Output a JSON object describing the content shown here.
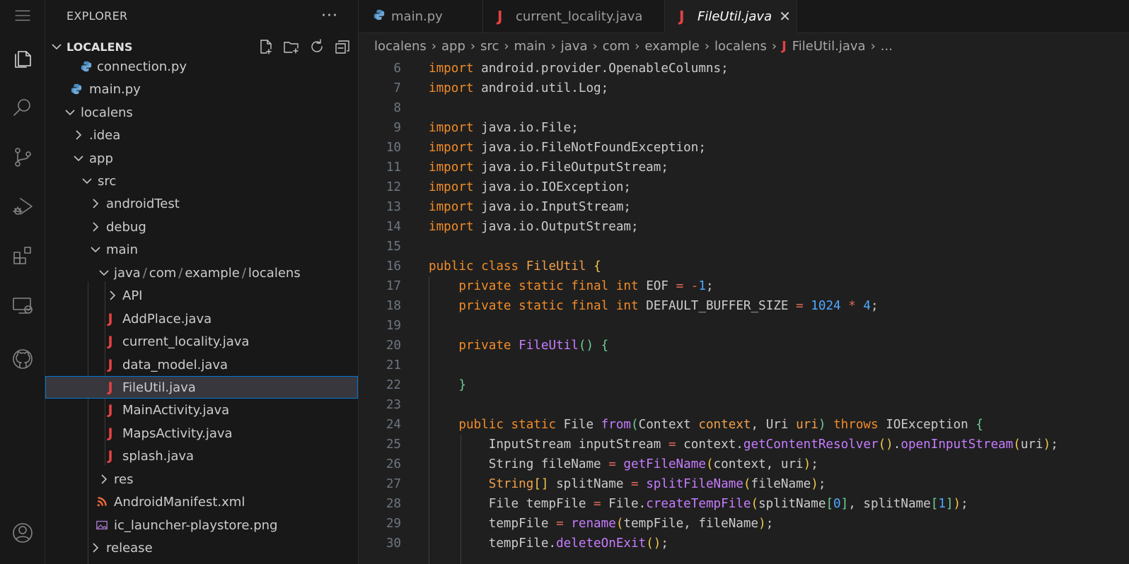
{
  "sidebar": {
    "title": "EXPLORER",
    "more": "···",
    "project": "LOCALENS",
    "tree": [
      {
        "label": "connection.py",
        "type": "py"
      },
      {
        "label": "main.py",
        "type": "py"
      },
      {
        "label": "localens",
        "type": "folder-open"
      },
      {
        "label": ".idea",
        "type": "folder"
      },
      {
        "label": "app",
        "type": "folder-open"
      },
      {
        "label": "src",
        "type": "folder-open"
      },
      {
        "label": "androidTest",
        "type": "folder"
      },
      {
        "label": "debug",
        "type": "folder"
      },
      {
        "label": "main",
        "type": "folder-open"
      },
      {
        "label": "java/com/example/localens",
        "type": "folder-open",
        "parts": [
          "java",
          "com",
          "example",
          "localens"
        ]
      },
      {
        "label": "API",
        "type": "folder"
      },
      {
        "label": "AddPlace.java",
        "type": "java"
      },
      {
        "label": "current_locality.java",
        "type": "java"
      },
      {
        "label": "data_model.java",
        "type": "java"
      },
      {
        "label": "FileUtil.java",
        "type": "java",
        "selected": true
      },
      {
        "label": "MainActivity.java",
        "type": "java"
      },
      {
        "label": "MapsActivity.java",
        "type": "java"
      },
      {
        "label": "splash.java",
        "type": "java"
      },
      {
        "label": "res",
        "type": "folder"
      },
      {
        "label": "AndroidManifest.xml",
        "type": "xml"
      },
      {
        "label": "ic_launcher-playstore.png",
        "type": "png"
      },
      {
        "label": "release",
        "type": "folder"
      }
    ]
  },
  "tabs": [
    {
      "label": "main.py",
      "icon": "python-icon"
    },
    {
      "label": "current_locality.java",
      "icon": "java-icon"
    },
    {
      "label": "FileUtil.java",
      "icon": "java-icon",
      "active": true,
      "close": "✕"
    }
  ],
  "breadcrumbs": [
    "localens",
    "app",
    "src",
    "main",
    "java",
    "com",
    "example",
    "localens",
    "FileUtil.java",
    "..."
  ],
  "editor": {
    "lines": [
      {
        "n": "6",
        "t": "import android.provider.OpenableColumns;"
      },
      {
        "n": "7",
        "t": "import android.util.Log;"
      },
      {
        "n": "8",
        "t": ""
      },
      {
        "n": "9",
        "t": "import java.io.File;"
      },
      {
        "n": "10",
        "t": "import java.io.FileNotFoundException;"
      },
      {
        "n": "11",
        "t": "import java.io.FileOutputStream;"
      },
      {
        "n": "12",
        "t": "import java.io.IOException;"
      },
      {
        "n": "13",
        "t": "import java.io.InputStream;"
      },
      {
        "n": "14",
        "t": "import java.io.OutputStream;"
      },
      {
        "n": "15",
        "t": ""
      },
      {
        "n": "16",
        "t": "public class FileUtil {"
      },
      {
        "n": "17",
        "t": "    private static final int EOF = -1;"
      },
      {
        "n": "18",
        "t": "    private static final int DEFAULT_BUFFER_SIZE = 1024 * 4;"
      },
      {
        "n": "19",
        "t": ""
      },
      {
        "n": "20",
        "t": "    private FileUtil() {"
      },
      {
        "n": "21",
        "t": ""
      },
      {
        "n": "22",
        "t": "    }"
      },
      {
        "n": "23",
        "t": ""
      },
      {
        "n": "24",
        "t": "    public static File from(Context context, Uri uri) throws IOException {"
      },
      {
        "n": "25",
        "t": "        InputStream inputStream = context.getContentResolver().openInputStream(uri);"
      },
      {
        "n": "26",
        "t": "        String fileName = getFileName(context, uri);"
      },
      {
        "n": "27",
        "t": "        String[] splitName = splitFileName(fileName);"
      },
      {
        "n": "28",
        "t": "        File tempFile = File.createTempFile(splitName[0], splitName[1]);"
      },
      {
        "n": "29",
        "t": "        tempFile = rename(tempFile, fileName);"
      },
      {
        "n": "30",
        "t": "        tempFile.deleteOnExit();"
      }
    ]
  },
  "colors": {
    "java": "#e44242",
    "python": "#4b8bbe",
    "xml": "#f26b3a",
    "png": "#a074c4",
    "selection_border": "#0078d4"
  }
}
